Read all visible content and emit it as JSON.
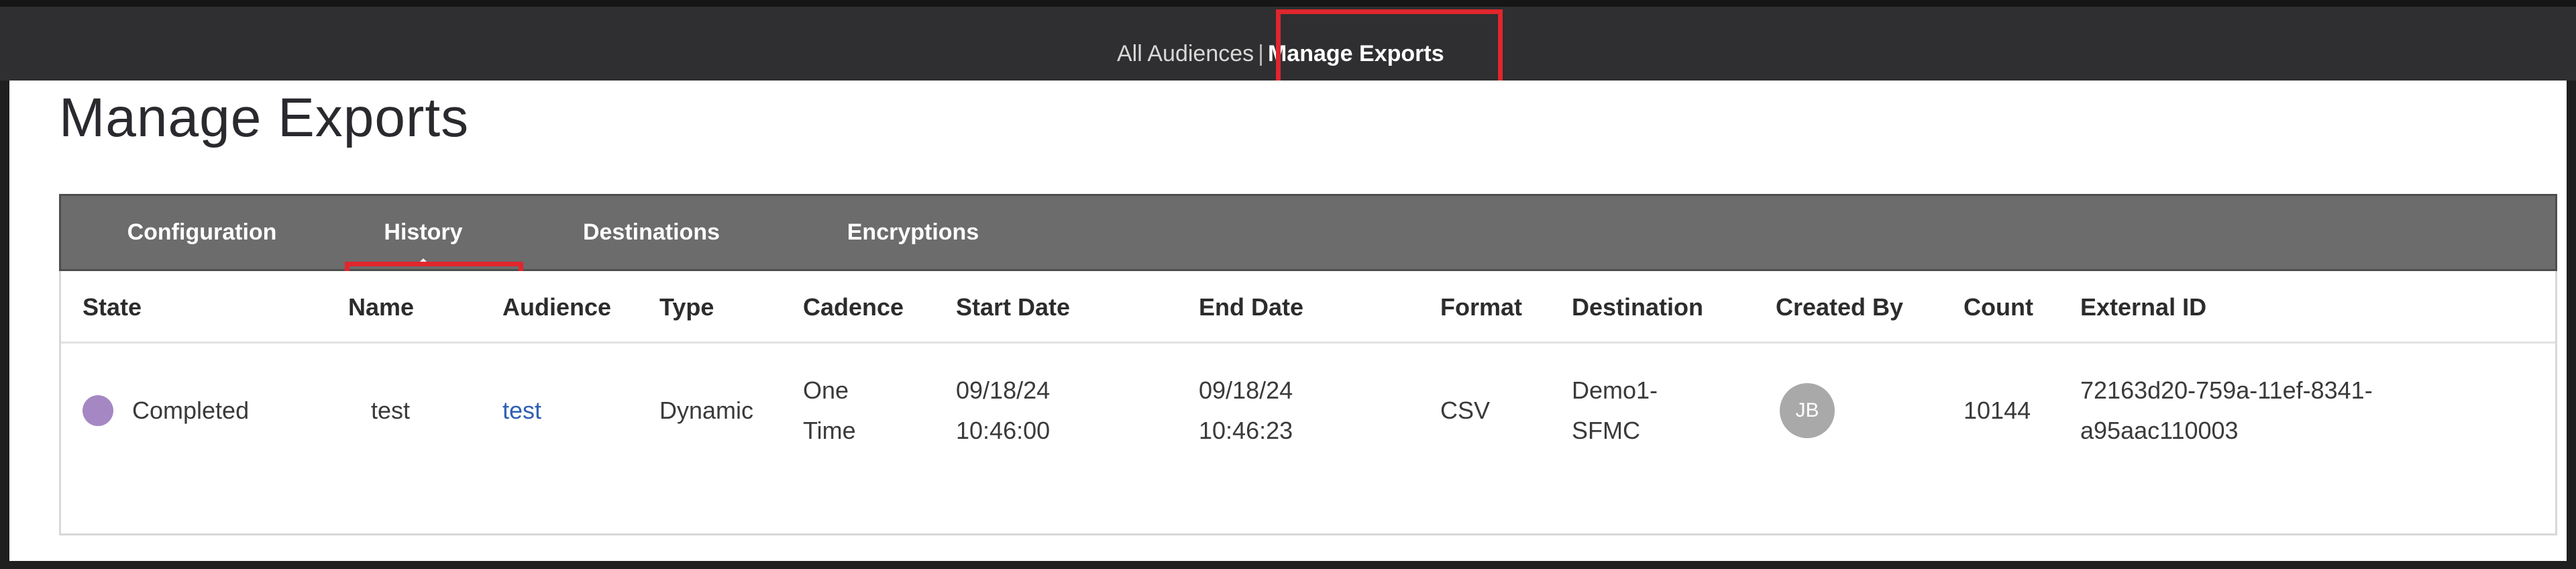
{
  "breadcrumb": {
    "items": [
      "All Audiences",
      "Manage Exports"
    ],
    "separator": "|"
  },
  "page": {
    "title": "Manage Exports"
  },
  "tabs": [
    {
      "label": "Configuration"
    },
    {
      "label": "History",
      "active": true
    },
    {
      "label": "Destinations"
    },
    {
      "label": "Encryptions"
    }
  ],
  "table": {
    "columns": [
      "State",
      "Name",
      "Audience",
      "Type",
      "Cadence",
      "Start Date",
      "End Date",
      "Format",
      "Destination",
      "Created By",
      "Count",
      "External ID"
    ],
    "rows": [
      {
        "state": "Completed",
        "state_color": "#a587c4",
        "name": "test",
        "audience": "test",
        "type": "Dynamic",
        "cadence_line1": "One",
        "cadence_line2": "Time",
        "start_date": "09/18/24",
        "start_time": "10:46:00",
        "end_date": "09/18/24",
        "end_time": "10:46:23",
        "format": "CSV",
        "destination_line1": "Demo1-",
        "destination_line2": "SFMC",
        "created_by_initials": "JB",
        "count": "10144",
        "external_id_line1": "72163d20-759a-11ef-8341-",
        "external_id_line2": "a95aac110003"
      }
    ]
  },
  "colors": {
    "highlight": "#e0262d",
    "tabs_bg": "#6c6c6c",
    "topbar_bg": "#2f2f31",
    "link": "#2f5fb3"
  }
}
